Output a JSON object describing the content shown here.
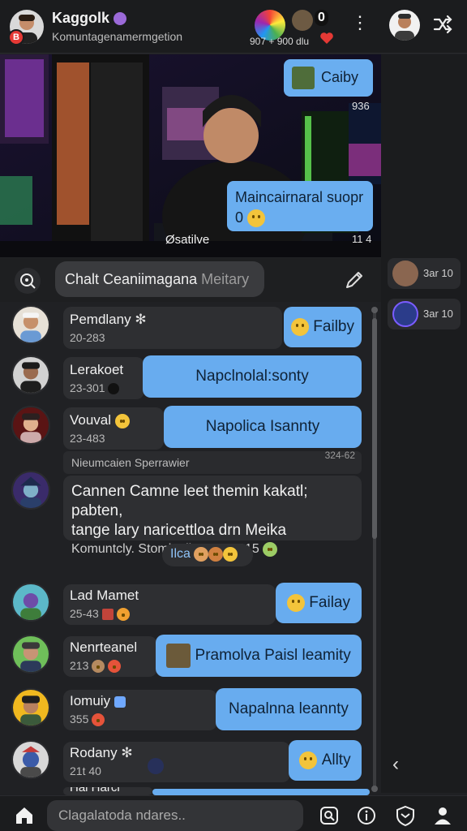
{
  "header": {
    "title": "Kaggolk",
    "subtitle": "Komuntagenamermgetion",
    "badge": "B",
    "stats": "907 + 900  dlu",
    "count": "0"
  },
  "stream": {
    "top_bubble": "Caiby",
    "top_time": "936",
    "caption": "Maincairnaral suopr",
    "caption_extra": "0",
    "overlay": "Øsatilve",
    "time": "11 4"
  },
  "rail": {
    "items": [
      {
        "label": "3ar 10"
      },
      {
        "label": "3ar 10"
      }
    ]
  },
  "search": {
    "value": "Chalt Ceaniimagana",
    "placeholder": "Meitary"
  },
  "messages": [
    {
      "name": "Pemdlany",
      "time": "20-283",
      "reply": "Failby"
    },
    {
      "name": "Lerakoet",
      "time": "23-301",
      "reply": "Napclnolal:sonty"
    },
    {
      "name": "Vouval",
      "time": "23-483",
      "reply": "Napolica Isannty"
    },
    {
      "name": "Lad Mamet",
      "time": "25-43",
      "reply": "Failay"
    },
    {
      "name": "Nenrteanel",
      "time": "213",
      "reply": "Pramolva Paisl leamity"
    },
    {
      "name": "Iomuiy",
      "time": "355",
      "reply": "Napalnna leannty"
    },
    {
      "name": "Rodany",
      "time": "21t 40",
      "reply": "Allty"
    },
    {
      "name": "Hal Harcl",
      "time": "",
      "reply": ""
    }
  ],
  "system": {
    "text": "Nieumcaien Sperrawier",
    "time": "324-62"
  },
  "long_message": {
    "line1": "Cannen Camne leet themin kakatl; pabten,",
    "line2": "tange lary naricettloa drn Meika",
    "line3": "Komuntcly. Stominalive 20. 3315"
  },
  "reaction": {
    "label": "Ilca"
  },
  "composer": {
    "placeholder": "Clagalatoda ndares.."
  },
  "colors": {
    "accent": "#68acef",
    "bg": "#202124",
    "badge": "#e53935"
  },
  "icons": [
    "home-icon",
    "search-icon",
    "pencil-icon",
    "shuffle-icon",
    "more-icon",
    "info-icon",
    "shield-icon",
    "profile-icon",
    "back-icon"
  ]
}
